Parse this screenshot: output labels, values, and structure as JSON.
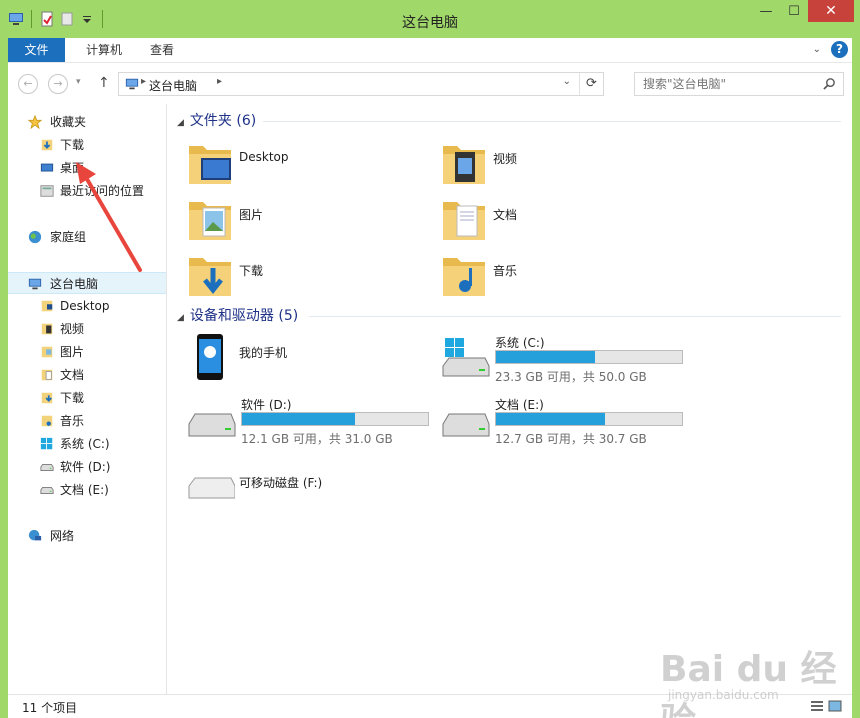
{
  "window": {
    "title": "这台电脑"
  },
  "ribbon": {
    "tabs": [
      "文件",
      "计算机",
      "查看"
    ]
  },
  "address": {
    "crumb": "这台电脑"
  },
  "search": {
    "placeholder": "搜索\"这台电脑\""
  },
  "sidebar": {
    "items": [
      {
        "label": "收藏夹",
        "icon": "star-icon"
      },
      {
        "label": "下载",
        "icon": "download-folder-icon"
      },
      {
        "label": "桌面",
        "icon": "desktop-icon"
      },
      {
        "label": "最近访问的位置",
        "icon": "recent-places-icon"
      },
      {
        "label": "家庭组",
        "icon": "homegroup-icon"
      },
      {
        "label": "这台电脑",
        "icon": "computer-icon"
      },
      {
        "label": "Desktop",
        "icon": "folder-icon"
      },
      {
        "label": "视频",
        "icon": "videos-folder-icon"
      },
      {
        "label": "图片",
        "icon": "pictures-folder-icon"
      },
      {
        "label": "文档",
        "icon": "documents-folder-icon"
      },
      {
        "label": "下载",
        "icon": "download-folder-icon"
      },
      {
        "label": "音乐",
        "icon": "music-folder-icon"
      },
      {
        "label": "系统 (C:)",
        "icon": "windows-drive-icon"
      },
      {
        "label": "软件 (D:)",
        "icon": "drive-icon"
      },
      {
        "label": "文档 (E:)",
        "icon": "drive-icon"
      },
      {
        "label": "网络",
        "icon": "network-icon"
      }
    ]
  },
  "folders": {
    "header": "文件夹 (6)",
    "items": [
      {
        "name": "Desktop",
        "icon": "desktop-folder-icon"
      },
      {
        "name": "视频",
        "icon": "videos-folder-icon"
      },
      {
        "name": "图片",
        "icon": "pictures-folder-icon"
      },
      {
        "name": "文档",
        "icon": "documents-folder-icon"
      },
      {
        "name": "下载",
        "icon": "downloads-folder-icon"
      },
      {
        "name": "音乐",
        "icon": "music-folder-icon"
      }
    ]
  },
  "devices": {
    "header": "设备和驱动器 (5)",
    "phone": {
      "name": "我的手机",
      "icon": "phone-icon"
    },
    "drives": [
      {
        "name": "系统 (C:)",
        "size": "23.3 GB 可用，共 50.0 GB",
        "used_fraction": 0.534,
        "icon": "windows-drive-icon"
      },
      {
        "name": "软件 (D:)",
        "size": "12.1 GB 可用，共 31.0 GB",
        "used_fraction": 0.61,
        "icon": "drive-icon"
      },
      {
        "name": "文档 (E:)",
        "size": "12.7 GB 可用，共 30.7 GB",
        "used_fraction": 0.586,
        "icon": "drive-icon"
      }
    ],
    "removable": {
      "name": "可移动磁盘 (F:)",
      "icon": "removable-drive-icon"
    }
  },
  "status": {
    "count": "11 个项目"
  },
  "watermark": {
    "brand": "Bai du 经验",
    "url": "jingyan.baidu.com"
  },
  "colors": {
    "accent": "#1c6fbd",
    "bar_fill": "#26a0da",
    "window_frame": "#a0d96a",
    "annotation": "#e8453c"
  }
}
